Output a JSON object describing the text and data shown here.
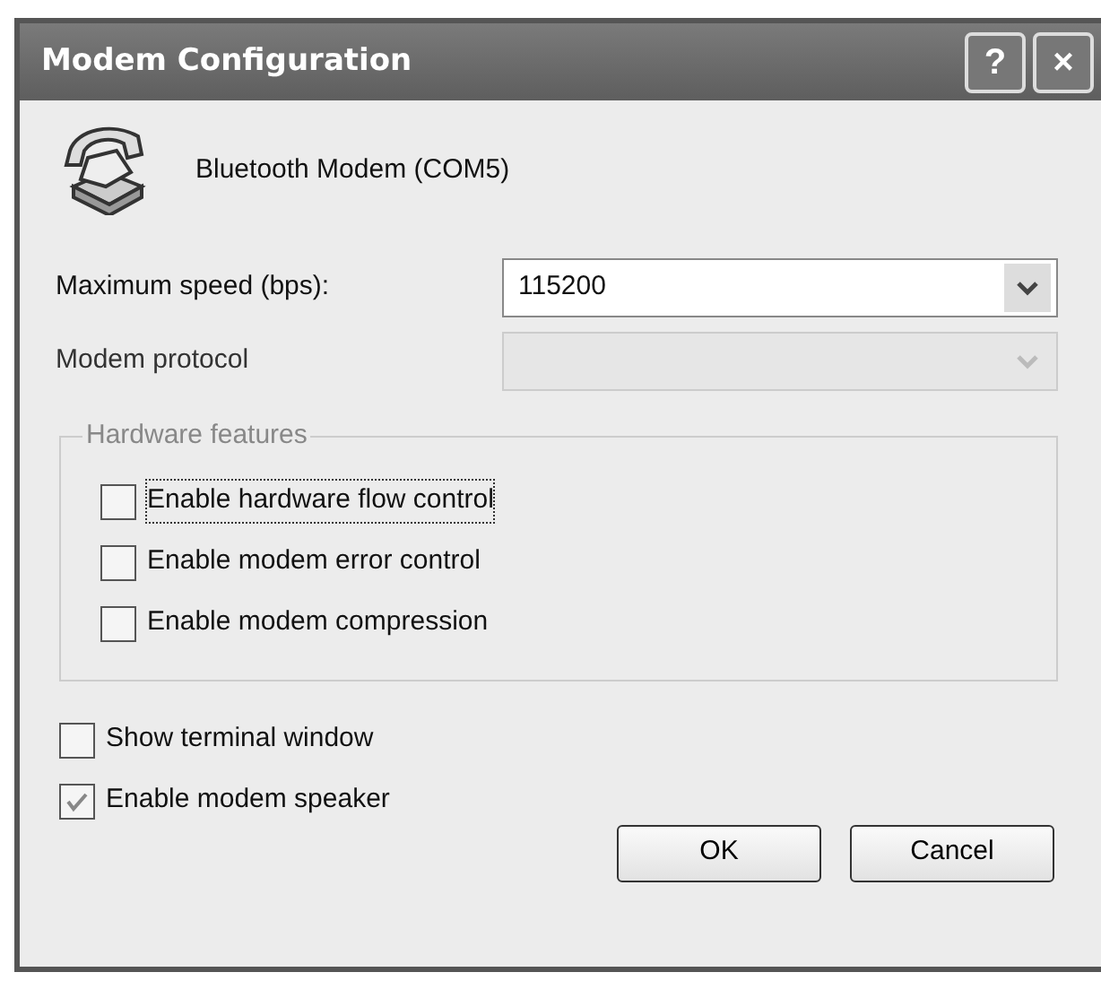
{
  "window": {
    "title": "Modem Configuration",
    "title_buttons": [
      "?",
      "×"
    ]
  },
  "device": {
    "name": "Bluetooth Modem (COM5)"
  },
  "fields": [
    {
      "label": "Maximum speed (bps):",
      "value": "115200",
      "disabled": false
    },
    {
      "label": "Modem protocol",
      "disabled": true
    }
  ],
  "hardware_features": {
    "title": "Hardware features",
    "options": [
      {
        "label": "Enable hardware flow control",
        "checked": false,
        "focused": true
      },
      {
        "label": "Enable modem error control",
        "checked": false,
        "focused": false
      },
      {
        "label": "Enable modem compression",
        "checked": false,
        "focused": false
      }
    ]
  },
  "options": [
    {
      "label": "Show terminal window",
      "checked": false,
      "focused": false
    },
    {
      "label": "Enable modem speaker",
      "checked": true,
      "focused": false
    }
  ],
  "buttons": [
    "OK",
    "Cancel"
  ]
}
